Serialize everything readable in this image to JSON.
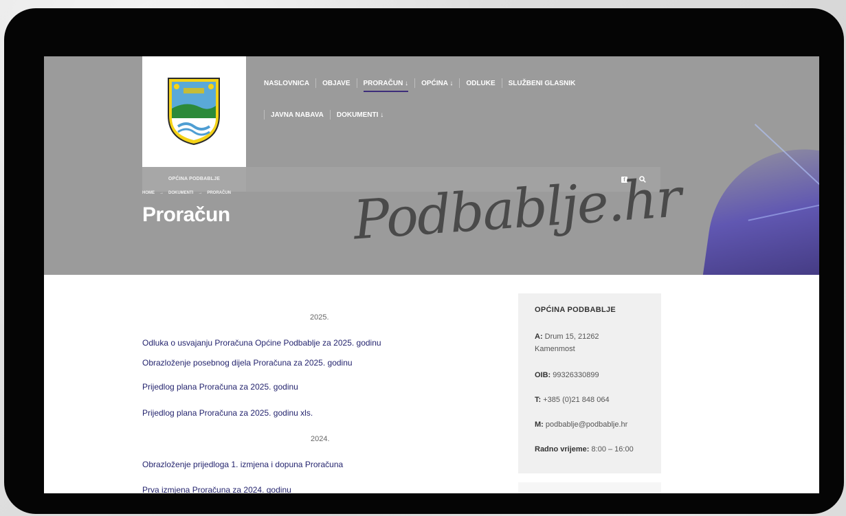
{
  "site": {
    "logo_caption": "OPĆINA PODBABLJE",
    "script_title": "Podbablje.hr"
  },
  "nav": {
    "row1": [
      "NASLOVNICA",
      "OBJAVE",
      "PRORAČUN ↓",
      "OPĆINA ↓",
      "ODLUKE",
      "SLUŽBENI GLASNIK"
    ],
    "row2": [
      "JAVNA NABAVA",
      "DOKUMENTI ↓"
    ],
    "active": "PRORAČUN ↓"
  },
  "breadcrumb": {
    "home": "HOME",
    "dokumenti": "DOKUMENTI",
    "current": "PRORAČUN",
    "arrow": "→"
  },
  "page": {
    "title": "Proračun"
  },
  "documents": {
    "year_2025": "2025.",
    "links_2025": [
      "Odluka o usvajanju Proračuna Općine Podbablje za 2025. godinu",
      "Obrazloženje posebnog dijela Proračuna za 2025. godinu",
      "Prijedlog plana Proračuna za 2025. godinu",
      "Prijedlog plana Proračuna za 2025. godinu xls."
    ],
    "year_2024": "2024.",
    "links_2024": [
      "Obrazloženje prijedloga 1. izmjena i dopuna Proračuna",
      "Prva izmjena Proračuna za 2024. godinu"
    ]
  },
  "sidebar": {
    "title": "OPĆINA PODBABLJE",
    "address_label": "A:",
    "address_line1": "Drum 15, 21262",
    "address_line2": "Kamenmost",
    "oib_label": "OIB:",
    "oib": "99326330899",
    "phone_label": "T:",
    "phone": "+385 (0)21 848 064",
    "email_label": "M:",
    "email": "podbablje@podbablje.hr",
    "hours_label": "Radno vrijeme:",
    "hours": "8:00 – 16:00"
  },
  "icons": {
    "social": "facebook-icon",
    "search": "search-icon"
  },
  "colors": {
    "hero": "#9b9b9b",
    "link": "#24246e",
    "active_underline": "#3d2d7a",
    "frame": "#050505"
  }
}
